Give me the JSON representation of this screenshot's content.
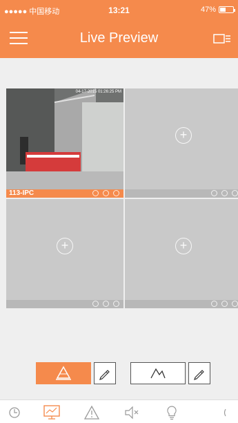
{
  "status_bar": {
    "carrier": "●●●●● 中国移动",
    "time": "13:21",
    "battery": "47%",
    "battery_level": 0.47
  },
  "header": {
    "title": "Live Preview"
  },
  "grid": {
    "cells": [
      {
        "label": "113-IPC",
        "timestamp": "04-17-2015 01:26:25 PM",
        "active": true
      },
      {
        "label": "",
        "active": false
      },
      {
        "label": "",
        "active": false
      },
      {
        "label": "",
        "active": false
      }
    ]
  },
  "controls": {
    "left_mode": "scene-icon",
    "right_mode": "mountain-icon"
  },
  "tabbar": {
    "icons": [
      "playback-icon",
      "monitor-icon",
      "alarm-icon",
      "mute-icon",
      "light-icon",
      "more-icon"
    ]
  },
  "colors": {
    "accent": "#f58a4c",
    "cell": "#c9c9c9"
  }
}
